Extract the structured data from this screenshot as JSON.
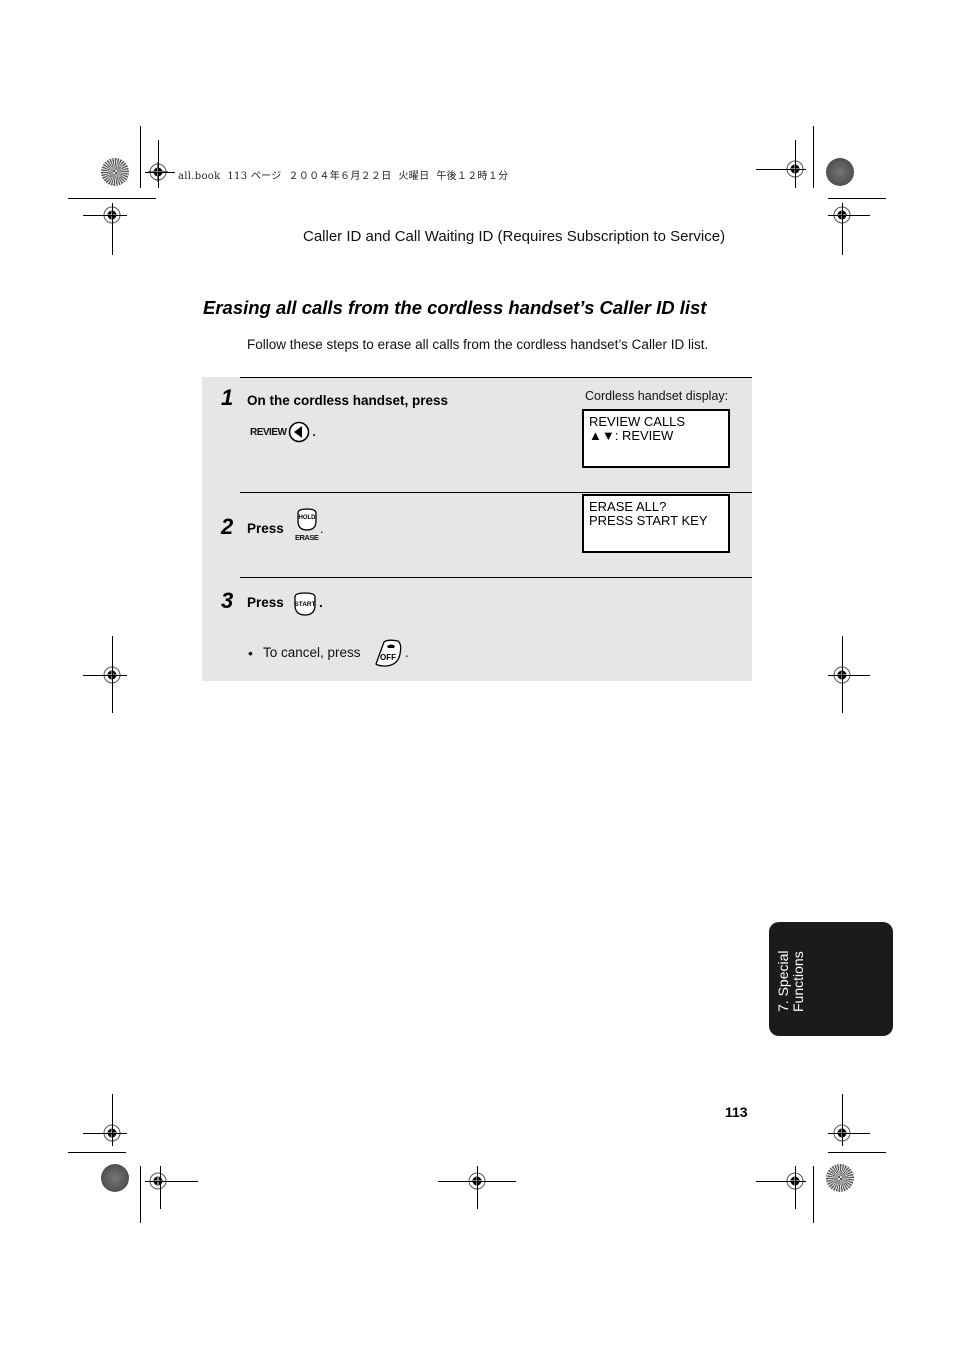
{
  "slug_line": "all.book  113 ページ  ２００４年６月２２日  火曜日  午後１２時１分",
  "running_head": "Caller ID and Call Waiting ID (Requires Subscription to Service)",
  "heading": "Erasing all calls from the cordless handset’s Caller ID list",
  "intro": "Follow these steps to erase all calls from the cordless handset’s Caller ID list.",
  "display_label": "Cordless handset display:",
  "steps": [
    {
      "number": "1",
      "text": "On the cordless handset, press",
      "key_label": "REVIEW",
      "key_icon": "left-arrow-key-icon",
      "suffix": ".",
      "display": [
        "REVIEW CALLS",
        "▲▼: REVIEW"
      ]
    },
    {
      "number": "2",
      "text": "Press",
      "key_top": "HOLD",
      "key_bottom": "ERASE",
      "key_icon": "hold-erase-key-icon",
      "suffix": ".",
      "display": [
        "ERASE ALL?",
        "PRESS START KEY"
      ]
    },
    {
      "number": "3",
      "text": "Press",
      "key_label": "START",
      "key_icon": "start-key-icon",
      "suffix": ".",
      "bullet": {
        "symbol": "•",
        "text": "To cancel, press",
        "key_label": "OFF",
        "key_icon": "phone-off-key-icon",
        "suffix": "."
      }
    }
  ],
  "side_tab": {
    "line1": "7. Special",
    "line2": "Functions"
  },
  "page_number": "113",
  "colors": {
    "panel_bg": "#e6e6e6",
    "tab_bg": "#1b1b1b"
  }
}
